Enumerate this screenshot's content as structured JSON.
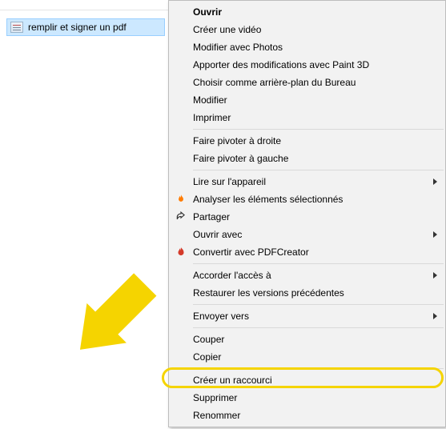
{
  "file": {
    "name": "remplir et signer un pdf"
  },
  "menu": {
    "ouvrir": "Ouvrir",
    "creer_video": "Créer une vidéo",
    "modifier_photos": "Modifier avec Photos",
    "paint3d": "Apporter des modifications avec Paint 3D",
    "bureau_bg": "Choisir comme arrière-plan du Bureau",
    "modifier": "Modifier",
    "imprimer": "Imprimer",
    "pivoter_droite": "Faire pivoter à droite",
    "pivoter_gauche": "Faire pivoter à gauche",
    "lire_appareil": "Lire sur l'appareil",
    "analyser": "Analyser les éléments sélectionnés",
    "partager": "Partager",
    "ouvrir_avec": "Ouvrir avec",
    "pdfcreator": "Convertir avec PDFCreator",
    "accorder_acces": "Accorder l'accès à",
    "restaurer": "Restaurer les versions précédentes",
    "envoyer_vers": "Envoyer vers",
    "couper": "Couper",
    "copier": "Copier",
    "creer_raccourci": "Créer un raccourci",
    "supprimer": "Supprimer",
    "renommer": "Renommer"
  }
}
